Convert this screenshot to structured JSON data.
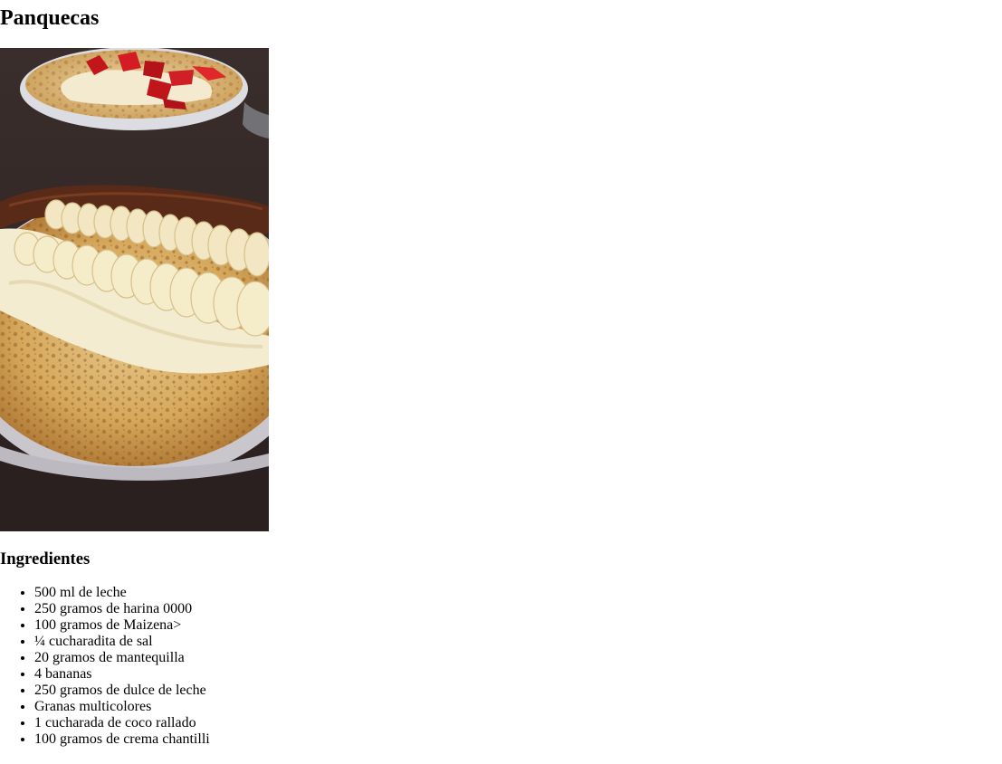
{
  "recipe": {
    "title": "Panquecas",
    "image_alt": "Panqueca con bananas, dulce de leche y crema chantilli",
    "ingredients_heading": "Ingredientes",
    "ingredients": [
      "500 ml de leche",
      "250 gramos de harina 0000",
      "100 gramos de Maizena>",
      "¼ cucharadita de sal",
      "20 gramos de mantequilla",
      "4 bananas",
      "250 gramos de dulce de leche",
      "Granas multicolores",
      "1 cucharada de coco rallado",
      "100 gramos de crema chantilli"
    ]
  }
}
